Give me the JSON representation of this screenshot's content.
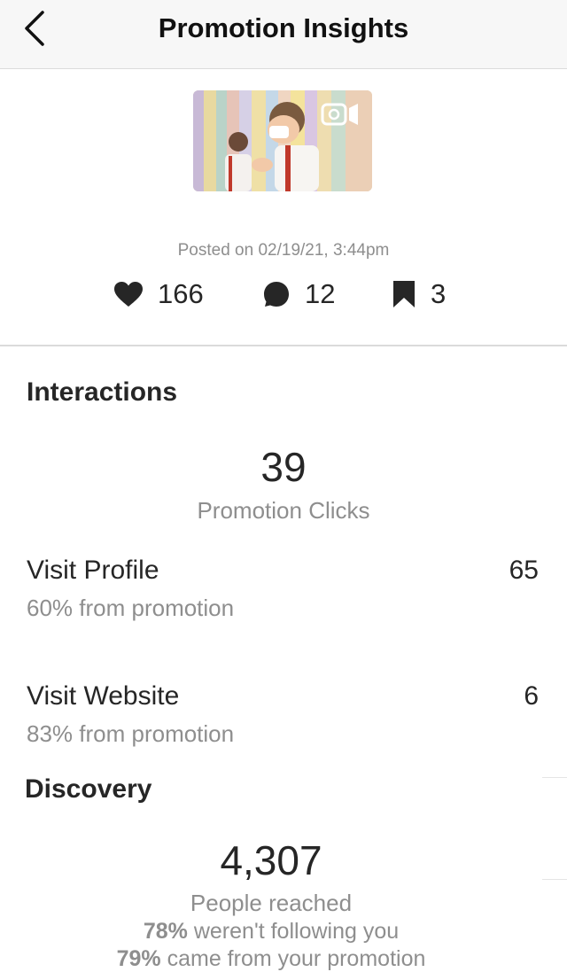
{
  "header": {
    "title": "Promotion Insights",
    "back_icon": "chevron-left-icon"
  },
  "post": {
    "thumbnail_icon": "video-camera-icon",
    "posted_text": "Posted on 02/19/21, 3:44pm",
    "likes": "166",
    "comments": "12",
    "saves": "3"
  },
  "interactions": {
    "title": "Interactions",
    "clicks_value": "39",
    "clicks_label": "Promotion Clicks",
    "rows": [
      {
        "label": "Visit Profile",
        "value": "65",
        "sub": "60% from promotion"
      },
      {
        "label": "Visit Website",
        "value": "6",
        "sub": "83% from promotion"
      }
    ]
  },
  "discovery": {
    "title": "Discovery",
    "reach_value": "4,307",
    "reach_label": "People reached",
    "line1_pct": "78%",
    "line1_text": " weren't following you",
    "line2_pct": "79%",
    "line2_text": " came from your promotion"
  }
}
